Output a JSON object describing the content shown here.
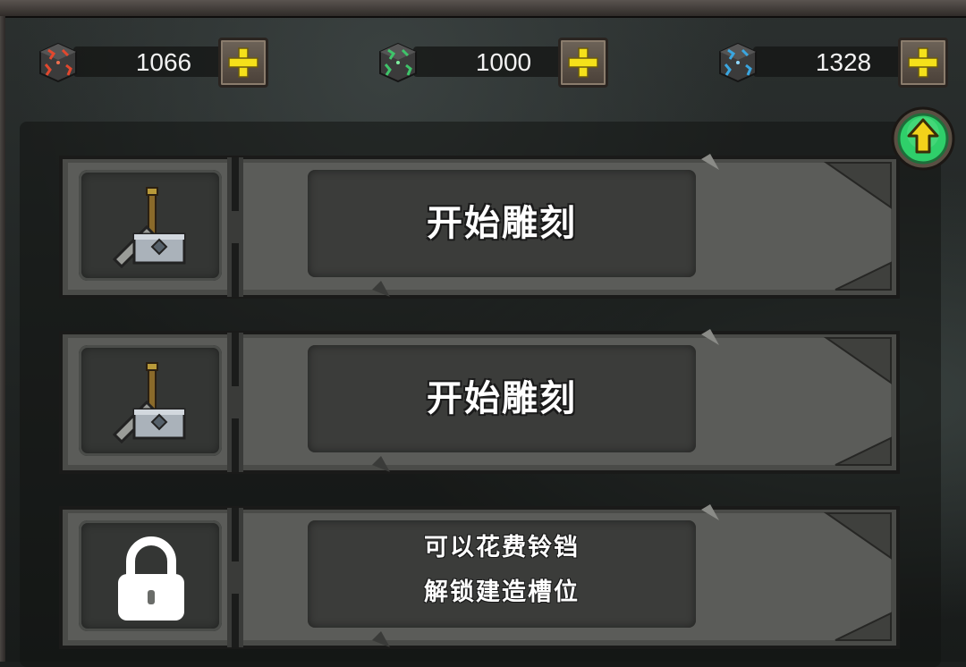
{
  "currencies": [
    {
      "name": "red-crystal",
      "amount": "1066",
      "color": "#d9503a"
    },
    {
      "name": "green-crystal",
      "amount": "1000",
      "color": "#3fc46a"
    },
    {
      "name": "blue-crystal",
      "amount": "1328",
      "color": "#3aa6e0"
    }
  ],
  "slots": [
    {
      "state": "available",
      "icon": "hammer-icon",
      "label": "开始雕刻"
    },
    {
      "state": "available",
      "icon": "hammer-icon",
      "label": "开始雕刻"
    },
    {
      "state": "locked",
      "icon": "lock-icon",
      "line1": "可以花费铃铛",
      "line2": "解锁建造槽位"
    }
  ],
  "colors": {
    "plus_icon": "#f5e11a",
    "upgrade_button": "#2fcf6a",
    "upgrade_arrow": "#f2d21a"
  }
}
